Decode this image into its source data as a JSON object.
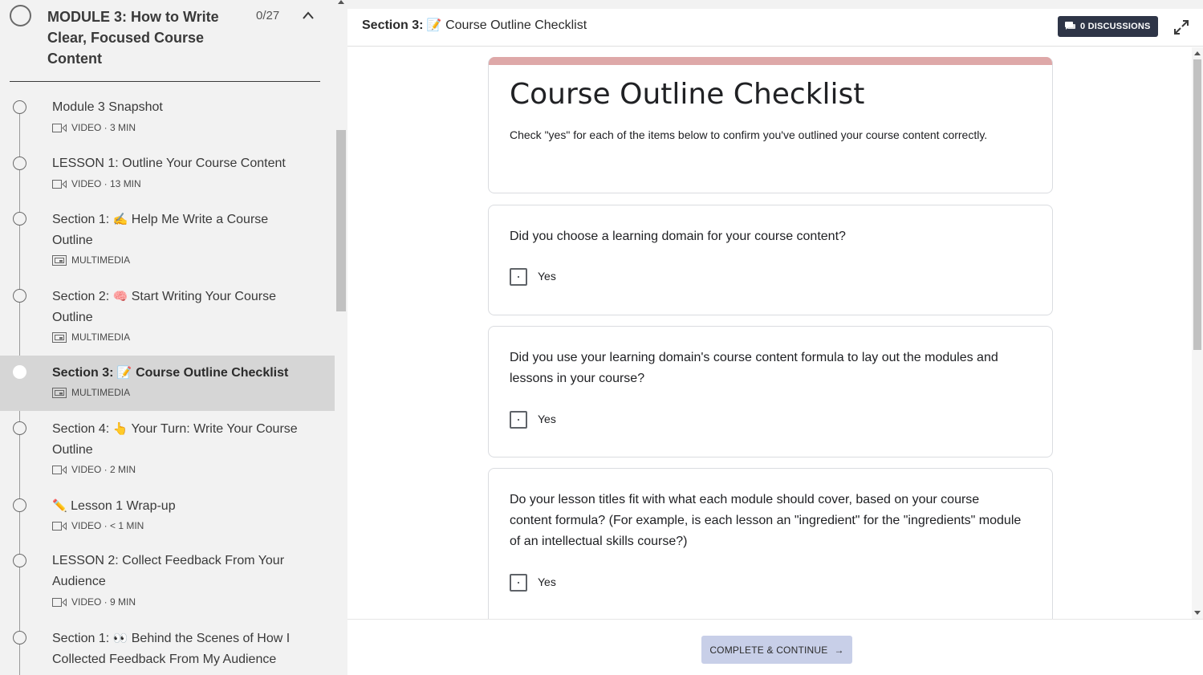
{
  "sidebar": {
    "module": {
      "title": "MODULE 3: How to Write Clear, Focused Course Content",
      "progress": "0/27"
    },
    "lessons": [
      {
        "title": "Module 3 Snapshot",
        "emoji": "",
        "type": "VIDEO · 3 MIN",
        "icon": "video-icon"
      },
      {
        "title": "LESSON 1: Outline Your Course Content",
        "emoji": "",
        "type": "VIDEO · 13 MIN",
        "icon": "video-icon"
      },
      {
        "prefix": "Section 1:",
        "emoji": "✍️",
        "title": "Help Me Write a Course Outline",
        "type": "MULTIMEDIA",
        "icon": "multimedia-icon"
      },
      {
        "prefix": "Section 2:",
        "emoji": "🧠",
        "title": "Start Writing Your Course Outline",
        "type": "MULTIMEDIA",
        "icon": "multimedia-icon"
      },
      {
        "prefix": "Section 3:",
        "emoji": "📝",
        "title": "Course Outline Checklist",
        "type": "MULTIMEDIA",
        "icon": "multimedia-icon"
      },
      {
        "prefix": "Section 4:",
        "emoji": "👆",
        "title": "Your Turn: Write Your Course Outline",
        "type": "VIDEO · 2 MIN",
        "icon": "video-icon"
      },
      {
        "prefix": "",
        "emoji": "✏️",
        "title": "Lesson 1 Wrap-up",
        "type": "VIDEO · < 1 MIN",
        "icon": "video-icon"
      },
      {
        "title": "LESSON 2: Collect Feedback From Your Audience",
        "emoji": "",
        "type": "VIDEO · 9 MIN",
        "icon": "video-icon"
      },
      {
        "prefix": "Section 1:",
        "emoji": "👀",
        "title": "Behind the Scenes of How I Collected Feedback From My Audience",
        "type": "",
        "icon": ""
      }
    ]
  },
  "topbar": {
    "section_prefix": "Section 3:",
    "section_emoji": "📝",
    "section_title": "Course Outline Checklist",
    "discussions_label": "0 DISCUSSIONS"
  },
  "form": {
    "title": "Course Outline Checklist",
    "description": "Check \"yes\" for each of the items below to confirm you've outlined your course content correctly.",
    "questions": [
      {
        "text": "Did you choose a learning domain for your course content?",
        "option": "Yes"
      },
      {
        "text": "Did you use your learning domain's course content formula to lay out the modules and lessons in your course?",
        "option": "Yes"
      },
      {
        "text": "Do your lesson titles fit with what each module should cover, based on your course content formula? (For example, is each lesson an \"ingredient\" for the \"ingredients\" module of an intellectual skills course?)",
        "option": "Yes"
      }
    ],
    "accent_color": "#dea8a8"
  },
  "footer": {
    "complete_label": "COMPLETE & CONTINUE",
    "arrow": "→"
  }
}
